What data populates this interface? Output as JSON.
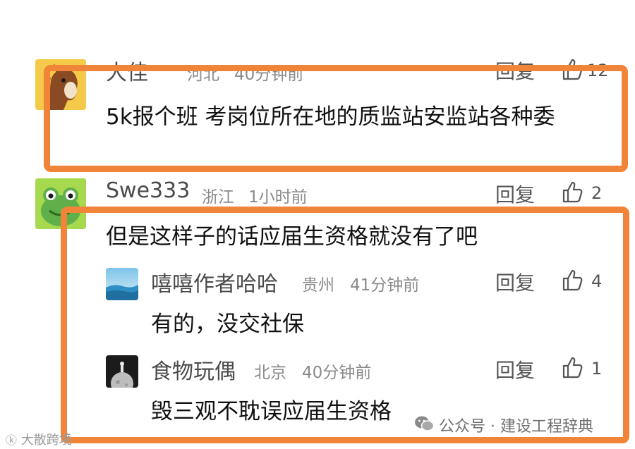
{
  "comments": [
    {
      "user": "大佳",
      "location": "河北",
      "time": "40分钟前",
      "reply_label": "回复",
      "likes": "12",
      "content": "5k报个班 考岗位所在地的质监站安监站各种委"
    },
    {
      "user": "Swe333",
      "location": "浙江",
      "time": "1小时前",
      "reply_label": "回复",
      "likes": "2",
      "content": "但是这样子的话应届生资格就没有了吧",
      "replies": [
        {
          "user": "嘻嘻作者哈哈",
          "location": "贵州",
          "time": "41分钟前",
          "reply_label": "回复",
          "likes": "4",
          "content": "有的，没交社保"
        },
        {
          "user": "食物玩偶",
          "location": "北京",
          "time": "40分钟前",
          "reply_label": "回复",
          "likes": "1",
          "content": "毁三观不耽误应届生资格"
        }
      ]
    }
  ],
  "watermark": {
    "text": "公众号 · 建设工程辞典",
    "corner_text": "大散跨境"
  },
  "colors": {
    "highlight": "#f0853a"
  }
}
